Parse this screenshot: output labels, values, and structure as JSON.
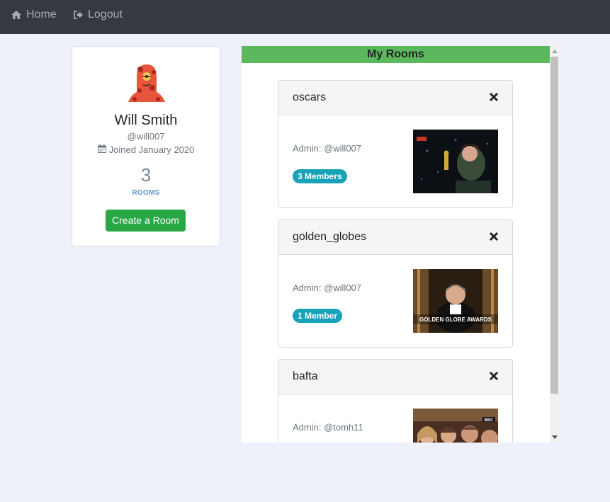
{
  "nav": {
    "home_label": "Home",
    "logout_label": "Logout"
  },
  "profile": {
    "name": "Will Smith",
    "handle": "@will007",
    "joined": "Joined January 2020",
    "rooms_count": "3",
    "rooms_label": "ROOMS",
    "create_button": "Create a Room"
  },
  "rooms_panel": {
    "title": "My Rooms",
    "rooms": [
      {
        "name": "oscars",
        "admin": "Admin: @will007",
        "members": "3 Members",
        "thumbnail": "oscars-image"
      },
      {
        "name": "golden_globes",
        "admin": "Admin: @will007",
        "members": "1 Member",
        "thumbnail": "golden-globes-image",
        "thumbnail_caption": "GOLDEN GLOBE AWARDS"
      },
      {
        "name": "bafta",
        "admin": "Admin: @tomh11",
        "members": "",
        "thumbnail": "bafta-image",
        "thumbnail_caption": "BBC"
      }
    ]
  },
  "colors": {
    "navbar": "#343a40",
    "page_background": "#eef1f9",
    "rooms_header": "#5cb85c",
    "create_button": "#28a745",
    "member_badge": "#17a2b8"
  },
  "icons": {
    "home": "home-icon",
    "logout": "logout-icon",
    "calendar": "calendar-icon",
    "close": "close-icon"
  }
}
